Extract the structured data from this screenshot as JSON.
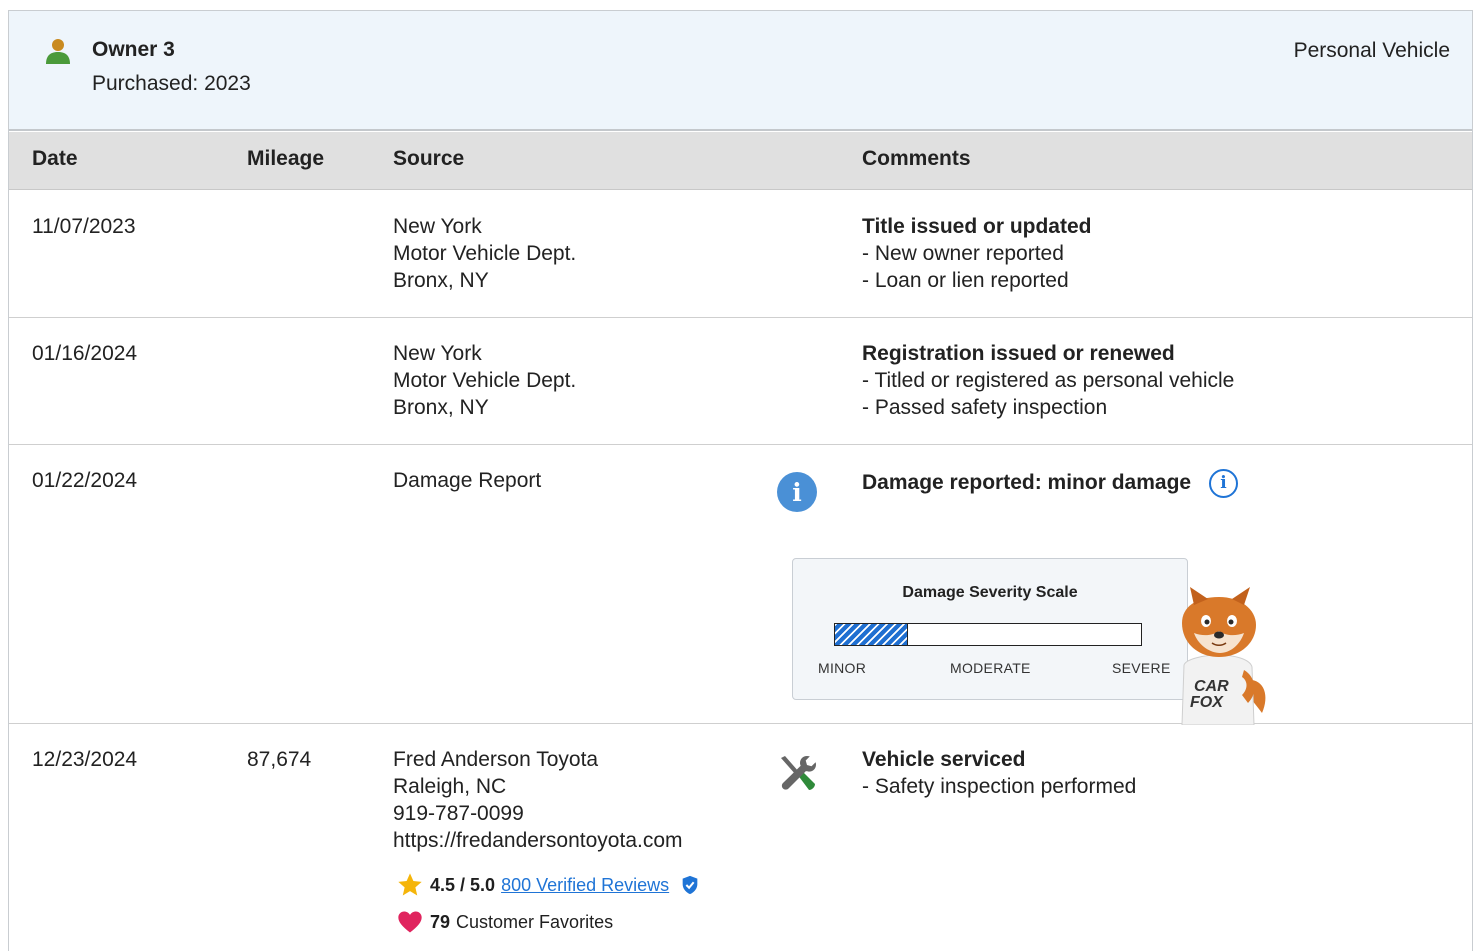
{
  "owner": {
    "name": "Owner 3",
    "purchased": "Purchased: 2023",
    "type": "Personal Vehicle"
  },
  "table": {
    "headers": {
      "date": "Date",
      "mileage": "Mileage",
      "source": "Source",
      "comments": "Comments"
    },
    "rows": [
      {
        "date": "11/07/2023",
        "mileage": "",
        "source": [
          "New York",
          "Motor Vehicle Dept.",
          "Bronx, NY"
        ],
        "comment_title": "Title issued or updated",
        "comment_items": [
          "- New owner reported",
          "- Loan or lien reported"
        ]
      },
      {
        "date": "01/16/2024",
        "mileage": "",
        "source": [
          "New York",
          "Motor Vehicle Dept.",
          "Bronx, NY"
        ],
        "comment_title": "Registration issued or renewed",
        "comment_items": [
          "- Titled or registered as personal vehicle",
          "- Passed safety inspection"
        ]
      },
      {
        "date": "01/22/2024",
        "mileage": "",
        "source": [
          "Damage Report"
        ],
        "comment_title": "Damage reported: minor damage",
        "severity": {
          "title": "Damage Severity Scale",
          "level": 0.24,
          "labels": {
            "minor": "MINOR",
            "moderate": "MODERATE",
            "severe": "SEVERE"
          },
          "fill_color": "#1f6fd1"
        },
        "icon": "info-icon"
      },
      {
        "date": "12/23/2024",
        "mileage": "87,674",
        "source": [
          "Fred Anderson Toyota",
          "Raleigh, NC",
          "919-787-0099",
          "https://fredandersontoyota.com"
        ],
        "comment_title": "Vehicle serviced",
        "comment_items": [
          "- Safety inspection performed"
        ],
        "rating": {
          "score": "4.5 / 5.0",
          "reviews_link": "800 Verified Reviews"
        },
        "favorites": {
          "count": "79",
          "label": "Customer Favorites"
        },
        "icon": "wrench-screwdriver-icon"
      }
    ]
  },
  "mascot": {
    "shirt_text_1": "CAR",
    "shirt_text_2": "FOX"
  },
  "colors": {
    "accent": "#1f74d6",
    "header_bg": "#eef5fb",
    "table_header_bg": "#e0e0e0",
    "owner_icon": "#4a9a3a",
    "star": "#f5b50a",
    "heart": "#e0245e"
  }
}
